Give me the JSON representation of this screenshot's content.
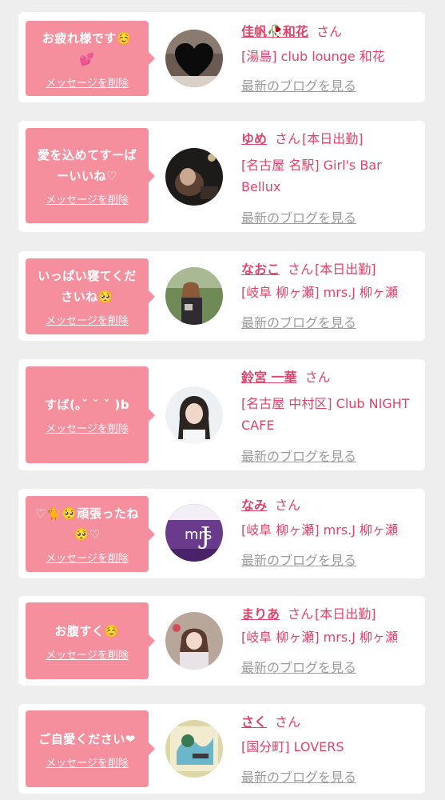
{
  "cards": [
    {
      "message": "お疲れ様です☺️\n💕",
      "delete_label": "メッセージを削除",
      "name": "佳帆🥀和花",
      "san": "さん",
      "badge": "",
      "shop": "[湯島] club lounge 和花",
      "blog_label": "最新のブログを見る"
    },
    {
      "message": "愛を込めてすーぱ\nーいいね♡",
      "delete_label": "メッセージを削除",
      "name": "ゆめ",
      "san": "さん",
      "badge": "[本日出勤]",
      "shop": "[名古屋 名駅] Girl's Bar Bellux",
      "blog_label": "最新のブログを見る"
    },
    {
      "message": "いっぱい寝てくだ\nさいね🥺",
      "delete_label": "メッセージを削除",
      "name": "なおこ",
      "san": "さん",
      "badge": "[本日出勤]",
      "shop": "[岐阜 柳ヶ瀬] mrs.J 柳ヶ瀬",
      "blog_label": "最新のブログを見る"
    },
    {
      "message": "すば(｡ˇ ˘ ˇ )b",
      "delete_label": "メッセージを削除",
      "name": "鈴宮 一華",
      "san": "さん",
      "badge": "",
      "shop": "[名古屋 中村区] Club NIGHT CAFE",
      "blog_label": "最新のブログを見る"
    },
    {
      "message": "♡🐈🥺頑張ったね\n🥺♡",
      "delete_label": "メッセージを削除",
      "name": "なみ",
      "san": "さん",
      "badge": "",
      "shop": "[岐阜 柳ヶ瀬] mrs.J 柳ヶ瀬",
      "blog_label": "最新のブログを見る"
    },
    {
      "message": "お腹すく☺️",
      "delete_label": "メッセージを削除",
      "name": "まりあ",
      "san": "さん",
      "badge": "[本日出勤]",
      "shop": "[岐阜 柳ヶ瀬] mrs.J 柳ヶ瀬",
      "blog_label": "最新のブログを見る"
    },
    {
      "message": "ご自愛ください❤",
      "delete_label": "メッセージを削除",
      "name": "さく",
      "san": "さん",
      "badge": "",
      "shop": "[国分町] LOVERS",
      "blog_label": "最新のブログを見る"
    }
  ],
  "colors": {
    "bubble": "#f58f9e",
    "accent": "#e0436a",
    "link_gray": "#9a9a9a",
    "background": "#eeeeee"
  }
}
